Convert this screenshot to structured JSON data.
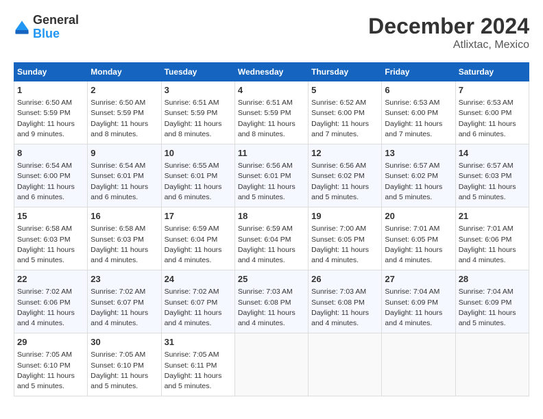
{
  "header": {
    "logo_line1": "General",
    "logo_line2": "Blue",
    "month": "December 2024",
    "location": "Atlixtac, Mexico"
  },
  "weekdays": [
    "Sunday",
    "Monday",
    "Tuesday",
    "Wednesday",
    "Thursday",
    "Friday",
    "Saturday"
  ],
  "weeks": [
    [
      {
        "day": "1",
        "sunrise": "6:50 AM",
        "sunset": "5:59 PM",
        "daylight": "11 hours and 9 minutes."
      },
      {
        "day": "2",
        "sunrise": "6:50 AM",
        "sunset": "5:59 PM",
        "daylight": "11 hours and 8 minutes."
      },
      {
        "day": "3",
        "sunrise": "6:51 AM",
        "sunset": "5:59 PM",
        "daylight": "11 hours and 8 minutes."
      },
      {
        "day": "4",
        "sunrise": "6:51 AM",
        "sunset": "5:59 PM",
        "daylight": "11 hours and 8 minutes."
      },
      {
        "day": "5",
        "sunrise": "6:52 AM",
        "sunset": "6:00 PM",
        "daylight": "11 hours and 7 minutes."
      },
      {
        "day": "6",
        "sunrise": "6:53 AM",
        "sunset": "6:00 PM",
        "daylight": "11 hours and 7 minutes."
      },
      {
        "day": "7",
        "sunrise": "6:53 AM",
        "sunset": "6:00 PM",
        "daylight": "11 hours and 6 minutes."
      }
    ],
    [
      {
        "day": "8",
        "sunrise": "6:54 AM",
        "sunset": "6:00 PM",
        "daylight": "11 hours and 6 minutes."
      },
      {
        "day": "9",
        "sunrise": "6:54 AM",
        "sunset": "6:01 PM",
        "daylight": "11 hours and 6 minutes."
      },
      {
        "day": "10",
        "sunrise": "6:55 AM",
        "sunset": "6:01 PM",
        "daylight": "11 hours and 6 minutes."
      },
      {
        "day": "11",
        "sunrise": "6:56 AM",
        "sunset": "6:01 PM",
        "daylight": "11 hours and 5 minutes."
      },
      {
        "day": "12",
        "sunrise": "6:56 AM",
        "sunset": "6:02 PM",
        "daylight": "11 hours and 5 minutes."
      },
      {
        "day": "13",
        "sunrise": "6:57 AM",
        "sunset": "6:02 PM",
        "daylight": "11 hours and 5 minutes."
      },
      {
        "day": "14",
        "sunrise": "6:57 AM",
        "sunset": "6:03 PM",
        "daylight": "11 hours and 5 minutes."
      }
    ],
    [
      {
        "day": "15",
        "sunrise": "6:58 AM",
        "sunset": "6:03 PM",
        "daylight": "11 hours and 5 minutes."
      },
      {
        "day": "16",
        "sunrise": "6:58 AM",
        "sunset": "6:03 PM",
        "daylight": "11 hours and 4 minutes."
      },
      {
        "day": "17",
        "sunrise": "6:59 AM",
        "sunset": "6:04 PM",
        "daylight": "11 hours and 4 minutes."
      },
      {
        "day": "18",
        "sunrise": "6:59 AM",
        "sunset": "6:04 PM",
        "daylight": "11 hours and 4 minutes."
      },
      {
        "day": "19",
        "sunrise": "7:00 AM",
        "sunset": "6:05 PM",
        "daylight": "11 hours and 4 minutes."
      },
      {
        "day": "20",
        "sunrise": "7:01 AM",
        "sunset": "6:05 PM",
        "daylight": "11 hours and 4 minutes."
      },
      {
        "day": "21",
        "sunrise": "7:01 AM",
        "sunset": "6:06 PM",
        "daylight": "11 hours and 4 minutes."
      }
    ],
    [
      {
        "day": "22",
        "sunrise": "7:02 AM",
        "sunset": "6:06 PM",
        "daylight": "11 hours and 4 minutes."
      },
      {
        "day": "23",
        "sunrise": "7:02 AM",
        "sunset": "6:07 PM",
        "daylight": "11 hours and 4 minutes."
      },
      {
        "day": "24",
        "sunrise": "7:02 AM",
        "sunset": "6:07 PM",
        "daylight": "11 hours and 4 minutes."
      },
      {
        "day": "25",
        "sunrise": "7:03 AM",
        "sunset": "6:08 PM",
        "daylight": "11 hours and 4 minutes."
      },
      {
        "day": "26",
        "sunrise": "7:03 AM",
        "sunset": "6:08 PM",
        "daylight": "11 hours and 4 minutes."
      },
      {
        "day": "27",
        "sunrise": "7:04 AM",
        "sunset": "6:09 PM",
        "daylight": "11 hours and 4 minutes."
      },
      {
        "day": "28",
        "sunrise": "7:04 AM",
        "sunset": "6:09 PM",
        "daylight": "11 hours and 5 minutes."
      }
    ],
    [
      {
        "day": "29",
        "sunrise": "7:05 AM",
        "sunset": "6:10 PM",
        "daylight": "11 hours and 5 minutes."
      },
      {
        "day": "30",
        "sunrise": "7:05 AM",
        "sunset": "6:10 PM",
        "daylight": "11 hours and 5 minutes."
      },
      {
        "day": "31",
        "sunrise": "7:05 AM",
        "sunset": "6:11 PM",
        "daylight": "11 hours and 5 minutes."
      },
      null,
      null,
      null,
      null
    ]
  ]
}
